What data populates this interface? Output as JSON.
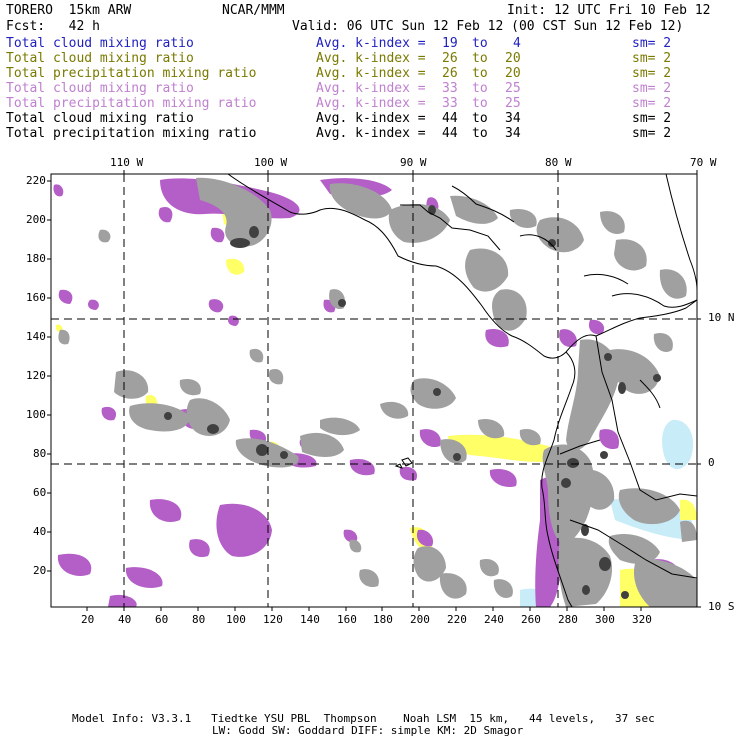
{
  "header": {
    "model": "TORERO  15km ARW",
    "org": "NCAR/MMM",
    "init": "Init: 12 UTC Fri 10 Feb 12",
    "fcst": "Fcst:   42 h",
    "valid": "Valid: 06 UTC Sun 12 Feb 12 (00 CST Sun 12 Feb 12)"
  },
  "legend": [
    {
      "field": "Total cloud mixing ratio",
      "label": "Avg. k-index =",
      "from": "19",
      "to_word": "to",
      "to": "4",
      "sm": "sm= 2",
      "color": "#1f1fbf"
    },
    {
      "field": "Total cloud mixing ratio",
      "label": "Avg. k-index =",
      "from": "26",
      "to_word": "to",
      "to": "20",
      "sm": "sm= 2",
      "color": "#7a7a00"
    },
    {
      "field": "Total precipitation mixing ratio",
      "label": "Avg. k-index =",
      "from": "26",
      "to_word": "to",
      "to": "20",
      "sm": "sm= 2",
      "color": "#7a7a00"
    },
    {
      "field": "Total cloud mixing ratio",
      "label": "Avg. k-index =",
      "from": "33",
      "to_word": "to",
      "to": "25",
      "sm": "sm= 2",
      "color": "#c080d0"
    },
    {
      "field": "Total precipitation mixing ratio",
      "label": "Avg. k-index =",
      "from": "33",
      "to_word": "to",
      "to": "25",
      "sm": "sm= 2",
      "color": "#c080d0"
    },
    {
      "field": "Total cloud mixing ratio",
      "label": "Avg. k-index =",
      "from": "44",
      "to_word": "to",
      "to": "34",
      "sm": "sm= 2",
      "color": "#000000"
    },
    {
      "field": "Total precipitation mixing ratio",
      "label": "Avg. k-index =",
      "from": "44",
      "to_word": "to",
      "to": "34",
      "sm": "sm= 2",
      "color": "#000000"
    }
  ],
  "map": {
    "lon_labels": [
      "110 W",
      "100 W",
      "90 W",
      "80 W",
      "70 W"
    ],
    "lat_labels": [
      "10 N",
      "0",
      "10 S"
    ],
    "x_ticks": [
      "20",
      "40",
      "60",
      "80",
      "100",
      "120",
      "140",
      "160",
      "180",
      "200",
      "220",
      "240",
      "260",
      "280",
      "300",
      "320"
    ],
    "y_ticks": [
      "220",
      "200",
      "180",
      "160",
      "140",
      "120",
      "100",
      "80",
      "60",
      "40",
      "20"
    ],
    "colors": {
      "purple": "#b45ec8",
      "gray": "#a0a0a0",
      "dark": "#404040",
      "yellow": "#ffff66",
      "lightblue": "#c8ecf8"
    }
  },
  "footer": {
    "line1": "Model Info: V3.3.1   Tiedtke YSU PBL  Thompson    Noah LSM  15 km,   44 levels,   37 sec",
    "line2": "LW: Godd SW: Goddard DIFF: simple KM: 2D Smagor"
  }
}
